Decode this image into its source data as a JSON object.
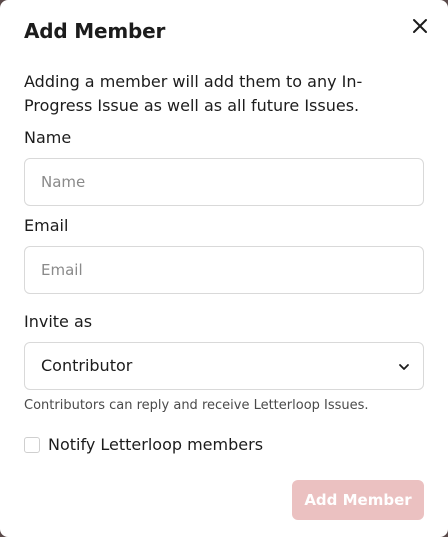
{
  "modal": {
    "title": "Add Member",
    "close_icon": "close-icon",
    "description": "Adding a member will add them to any In-Progress Issue as well as all future Issues."
  },
  "form": {
    "name": {
      "label": "Name",
      "placeholder": "Name",
      "value": ""
    },
    "email": {
      "label": "Email",
      "placeholder": "Email",
      "value": ""
    },
    "role": {
      "label": "Invite as",
      "selected": "Contributor",
      "chevron_icon": "chevron-down-icon",
      "hint": "Contributors can reply and receive Letterloop Issues."
    },
    "notify": {
      "label": "Notify Letterloop members",
      "checked": false
    }
  },
  "actions": {
    "submit_label": "Add Member",
    "submit_color": "#ebc1c1"
  }
}
